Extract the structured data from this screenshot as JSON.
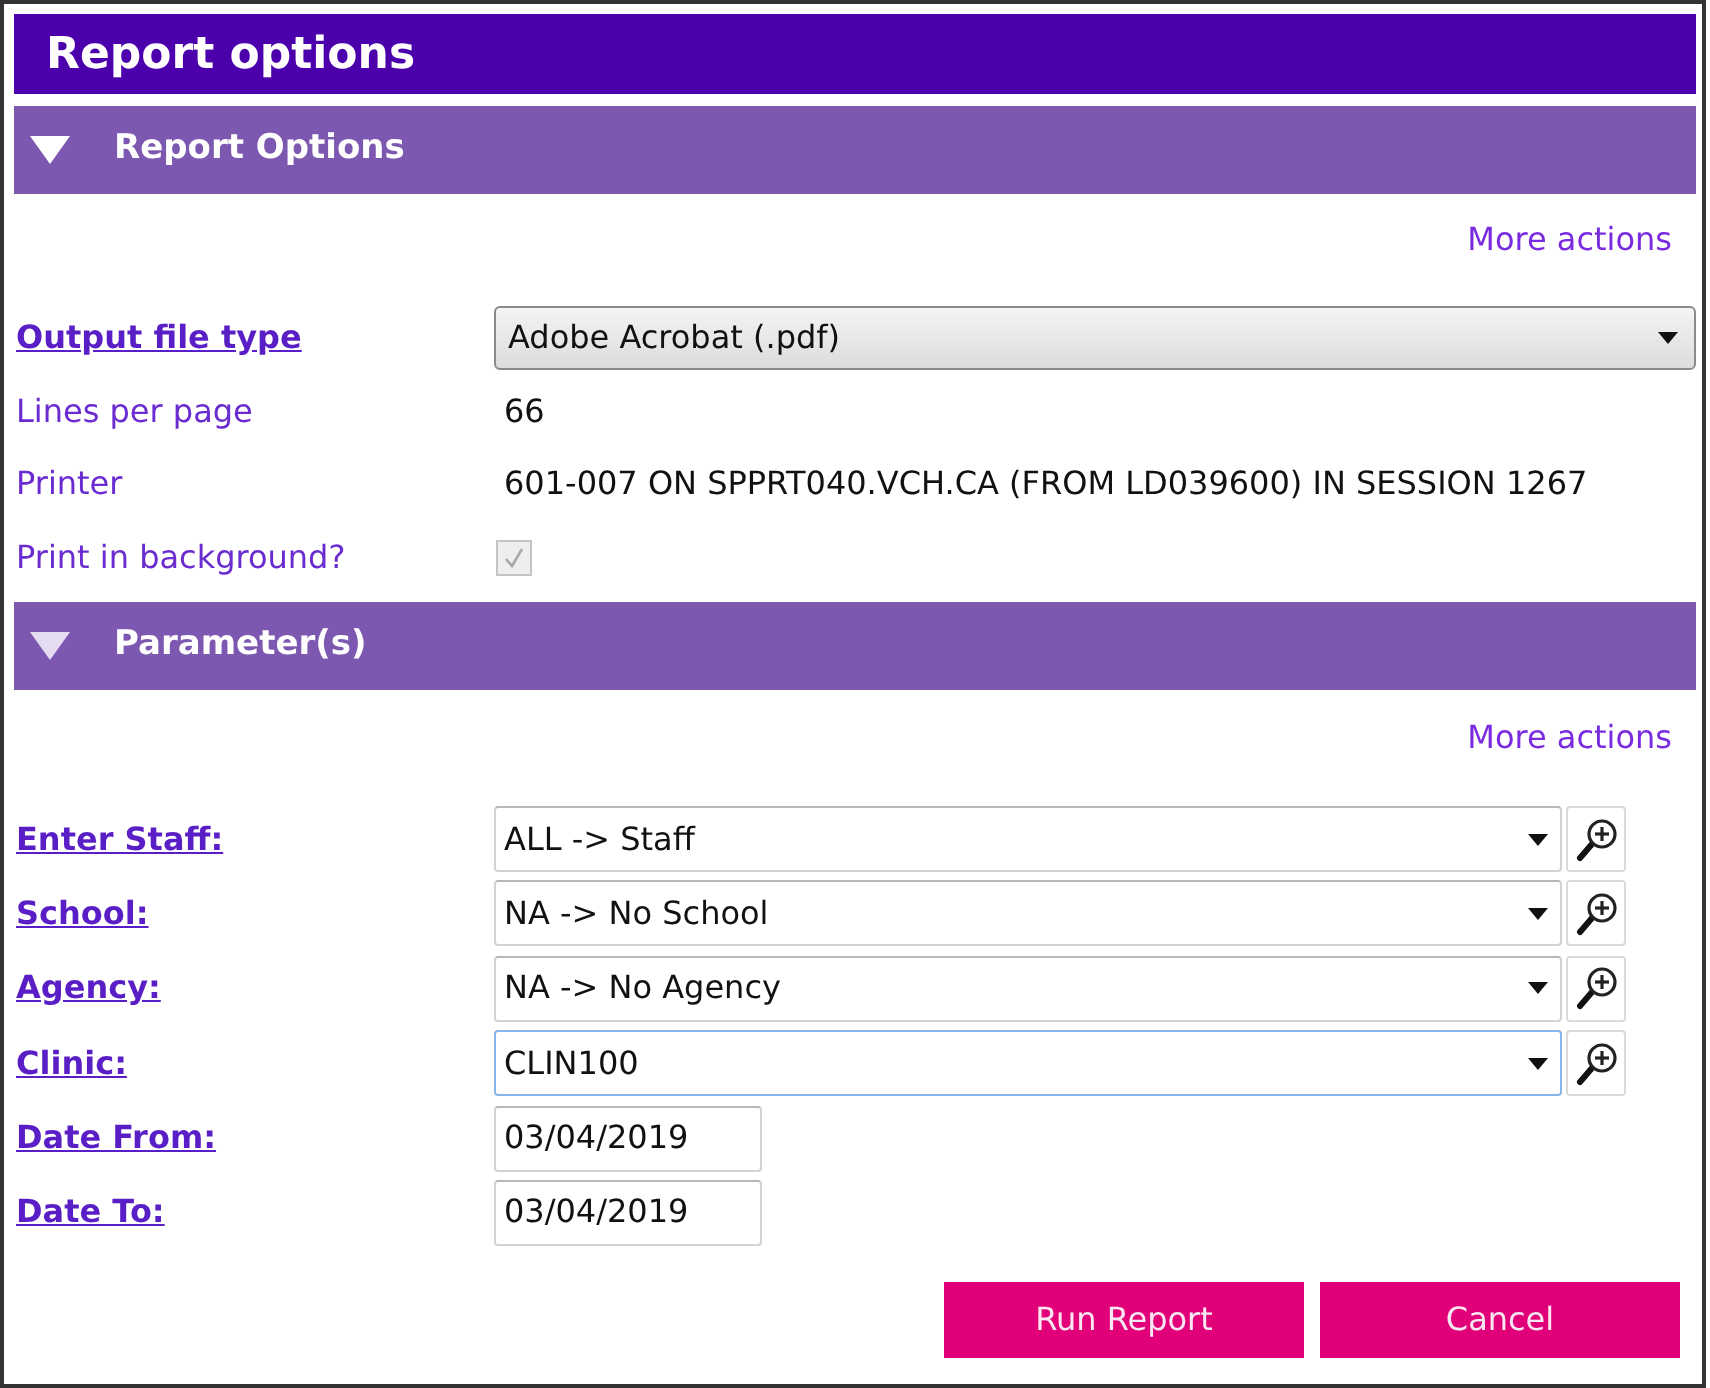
{
  "window": {
    "title": "Report options"
  },
  "sections": [
    {
      "title": "Report Options",
      "expanded": true,
      "more_actions": "More actions",
      "fields": [
        {
          "kind": "select",
          "label": "Output file type",
          "link": true,
          "value": "Adobe Acrobat (.pdf)"
        },
        {
          "kind": "text",
          "label": "Lines per page",
          "link": false,
          "value": "66"
        },
        {
          "kind": "text",
          "label": "Printer",
          "link": false,
          "value": "601-007 ON SPPRT040.VCH.CA (FROM LD039600) IN SESSION 1267"
        },
        {
          "kind": "checkbox",
          "label": "Print in background?",
          "link": false,
          "checked": true,
          "disabled": true
        }
      ]
    },
    {
      "title": "Parameter(s)",
      "expanded": true,
      "more_actions": "More actions",
      "fields": [
        {
          "kind": "lookup",
          "label": "Enter Staff:",
          "link": true,
          "value": "ALL -> Staff",
          "focused": false
        },
        {
          "kind": "lookup",
          "label": "School:",
          "link": true,
          "value": "NA -> No School",
          "focused": false
        },
        {
          "kind": "lookup",
          "label": "Agency:",
          "link": true,
          "value": "NA -> No Agency",
          "focused": false
        },
        {
          "kind": "lookup",
          "label": "Clinic:",
          "link": true,
          "value": "CLIN100",
          "focused": true
        },
        {
          "kind": "date",
          "label": "Date From:",
          "link": true,
          "value": "03/04/2019"
        },
        {
          "kind": "date",
          "label": "Date To:",
          "link": true,
          "value": "03/04/2019"
        }
      ]
    }
  ],
  "buttons": [
    "Run Report",
    "Cancel"
  ]
}
